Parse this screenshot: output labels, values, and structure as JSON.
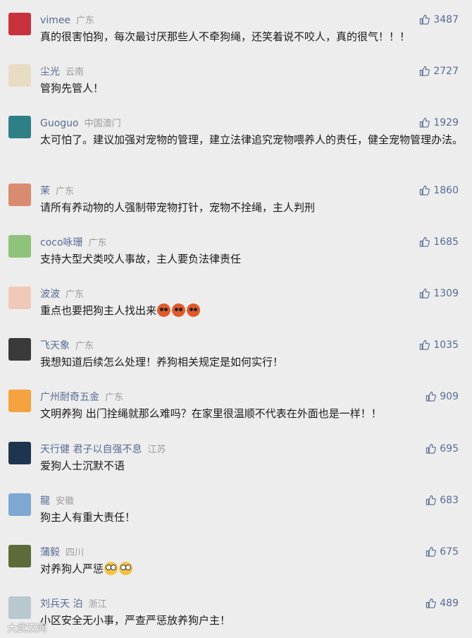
{
  "comments": [
    {
      "nickname": "vimee",
      "location": "广东",
      "likes": "3487",
      "text": "真的很害怕狗，每次最讨厌那些人不牵狗绳，还笑着说不咬人，真的很气！！！",
      "avatar_color": "#c8323b"
    },
    {
      "nickname": "尘光",
      "location": "云南",
      "likes": "2727",
      "text": "管狗先管人！",
      "avatar_color": "#e9dcc4"
    },
    {
      "nickname": "Guoguo",
      "location": "中国澳门",
      "likes": "1929",
      "text": "太可怕了。建议加强对宠物的管理，建立法律追究宠物喂养人的责任，健全宠物管理办法。",
      "avatar_color": "#2f7f87"
    },
    {
      "nickname": "茉",
      "location": "广东",
      "likes": "1860",
      "text": "请所有养动物的人强制带宠物打针，宠物不拴绳，主人判刑",
      "avatar_color": "#d98b70"
    },
    {
      "nickname": "coco咏珊",
      "location": "广东",
      "likes": "1685",
      "text": "支持大型犬类咬人事故，主人要负法律责任",
      "avatar_color": "#8fc27a"
    },
    {
      "nickname": "波波",
      "location": "广东",
      "likes": "1309",
      "text": "重点也要把狗主人找出来",
      "emojis": [
        "angry",
        "angry",
        "angry"
      ],
      "avatar_color": "#f0c8b8"
    },
    {
      "nickname": "飞天象",
      "location": "广东",
      "likes": "1035",
      "text": "我想知道后续怎么处理！养狗相关规定是如何实行！",
      "avatar_color": "#3a3a3a"
    },
    {
      "nickname": "广州耐奇五金",
      "location": "广东",
      "likes": "909",
      "text": "文明养狗 出门拴绳就那么难吗？在家里很温顺不代表在外面也是一样！！",
      "avatar_color": "#f4a340"
    },
    {
      "nickname": "天行健 君子以自强不息",
      "location": "江苏",
      "likes": "695",
      "text": "爱狗人士沉默不语",
      "avatar_color": "#1e3550"
    },
    {
      "nickname": "龍",
      "location": "安徽",
      "likes": "683",
      "text": "狗主人有重大责任！",
      "avatar_color": "#7ea7d2"
    },
    {
      "nickname": "蒲毅",
      "location": "四川",
      "likes": "675",
      "text": "对养狗人严惩",
      "emojis": [
        "wow",
        "wow"
      ],
      "avatar_color": "#5d6a3a"
    },
    {
      "nickname": "刘兵天 泊",
      "location": "浙江",
      "likes": "489",
      "text": "小区安全无小事，严查严惩放养狗户主！",
      "avatar_color": "#b9c7cf"
    }
  ],
  "watermark": "大武汉网"
}
